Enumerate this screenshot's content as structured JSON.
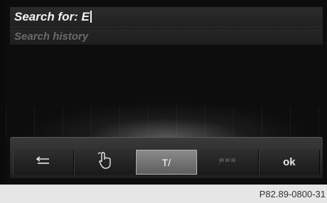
{
  "search": {
    "label": "Search for: E"
  },
  "history": {
    "label": "Search history"
  },
  "toolbar": {
    "buttons": [
      {
        "icon": "back-arrow-icon",
        "label": ""
      },
      {
        "icon": "handwriting-icon",
        "label": ""
      },
      {
        "icon": "text-cursor-icon",
        "label": "T/"
      },
      {
        "icon": "flag-icon",
        "label": ""
      },
      {
        "icon": "",
        "label": "ok"
      }
    ]
  },
  "footer": {
    "reference": "P82.89-0800-31"
  }
}
